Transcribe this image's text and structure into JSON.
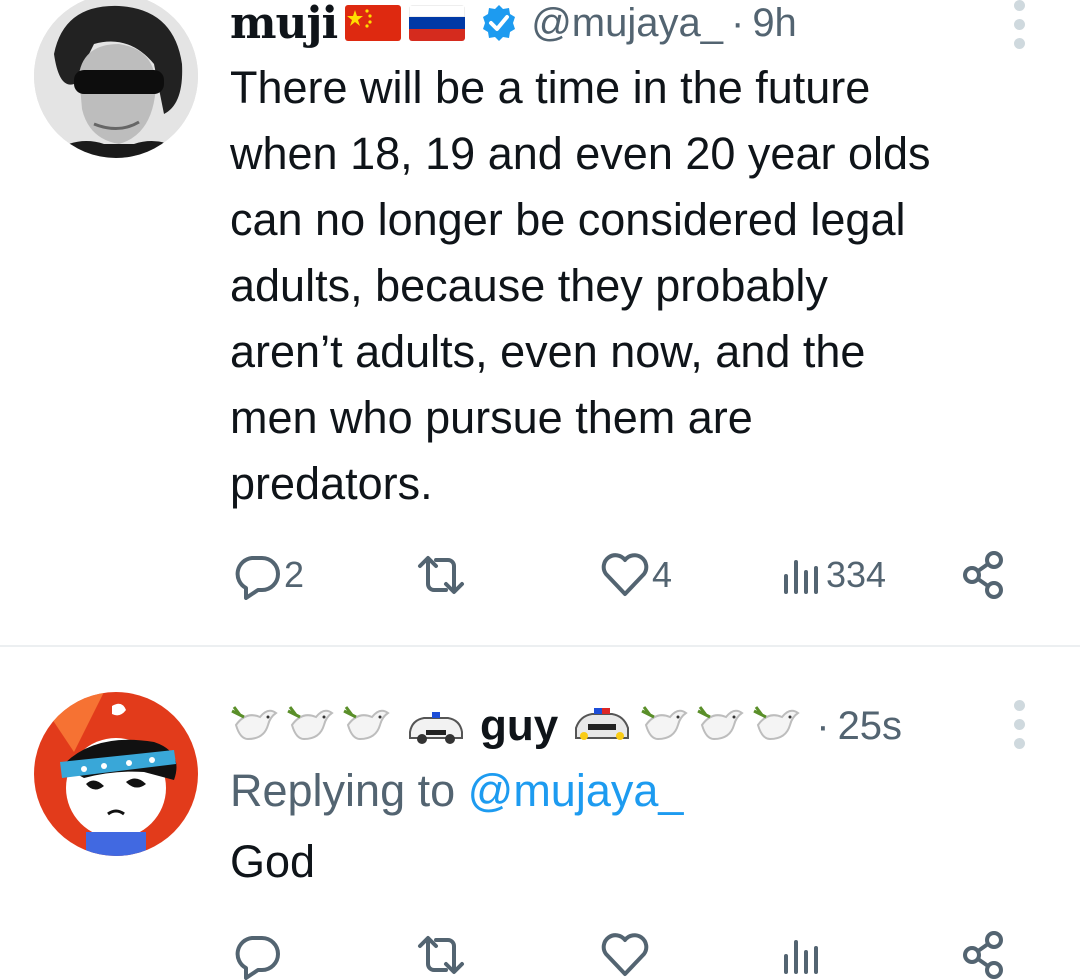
{
  "tweets": [
    {
      "author": {
        "name": "muji",
        "flags": [
          "china-flag",
          "russia-flag"
        ],
        "verified": true,
        "handle": "@mujaya_",
        "dot": "·",
        "time": "9h"
      },
      "text_lines": [
        "There will be a time in the future",
        "when 18, 19 and even 20 year olds",
        "can no longer be considered legal",
        "adults, because they probably",
        "aren’t adults, even now, and the",
        "men who pursue them are",
        "predators."
      ],
      "actions": {
        "replies": "2",
        "retweets": "",
        "likes": "4",
        "views": "334"
      }
    },
    {
      "author": {
        "name": "guy",
        "decor_left": [
          "dove-icon",
          "dove-icon",
          "dove-icon",
          "police-car-icon"
        ],
        "decor_right": [
          "police-car-icon",
          "dove-icon",
          "dove-icon",
          "dove-icon"
        ],
        "dot": "·",
        "time": "25s"
      },
      "replying_prefix": "Replying to ",
      "replying_to": "@mujaya_",
      "text": "God"
    }
  ],
  "colors": {
    "text": "#0f1419",
    "secondary": "#536471",
    "link": "#1d9bf0",
    "verified": "#1d9bf0",
    "divider": "#eceff1"
  }
}
